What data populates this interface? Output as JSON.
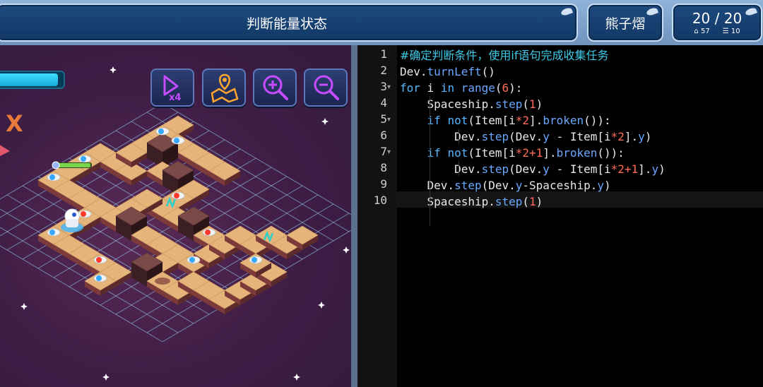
{
  "header": {
    "title": "判断能量状态",
    "user_name": "熊子熠",
    "score": "20 / 20",
    "stat_left": "57",
    "stat_right": "10"
  },
  "toolbar": {
    "speed_label": "x4",
    "tools": [
      "speed-x4-icon",
      "map-route-icon",
      "zoom-in-icon",
      "zoom-out-icon"
    ]
  },
  "game": {
    "x_marker": "X",
    "energy_level": 0.92
  },
  "editor": {
    "line_numbers": [
      "1",
      "2",
      "3",
      "4",
      "5",
      "6",
      "7",
      "8",
      "9",
      "10"
    ],
    "lines": [
      [
        {
          "t": "cm",
          "v": "#确定判断条件，使用if语句完成收集任务"
        }
      ],
      [
        {
          "t": "fn",
          "v": "Dev."
        },
        {
          "t": "me",
          "v": "turnLeft"
        },
        {
          "t": "fn",
          "v": "()"
        }
      ],
      [
        {
          "t": "kw",
          "v": "for"
        },
        {
          "t": "fn",
          "v": " i "
        },
        {
          "t": "kw",
          "v": "in"
        },
        {
          "t": "fn",
          "v": " "
        },
        {
          "t": "me",
          "v": "range"
        },
        {
          "t": "fn",
          "v": "("
        },
        {
          "t": "num",
          "v": "6"
        },
        {
          "t": "fn",
          "v": "):"
        }
      ],
      [
        {
          "t": "fn",
          "v": "    Spaceship."
        },
        {
          "t": "me",
          "v": "step"
        },
        {
          "t": "fn",
          "v": "("
        },
        {
          "t": "num",
          "v": "1"
        },
        {
          "t": "fn",
          "v": ")"
        }
      ],
      [
        {
          "t": "fn",
          "v": "    "
        },
        {
          "t": "kw",
          "v": "if"
        },
        {
          "t": "fn",
          "v": " "
        },
        {
          "t": "kw",
          "v": "not"
        },
        {
          "t": "fn",
          "v": "(Item[i"
        },
        {
          "t": "num",
          "v": "*2"
        },
        {
          "t": "fn",
          "v": "]."
        },
        {
          "t": "me",
          "v": "broken"
        },
        {
          "t": "fn",
          "v": "()):"
        }
      ],
      [
        {
          "t": "fn",
          "v": "        Dev."
        },
        {
          "t": "me",
          "v": "step"
        },
        {
          "t": "fn",
          "v": "(Dev."
        },
        {
          "t": "me",
          "v": "y"
        },
        {
          "t": "fn",
          "v": " - Item[i"
        },
        {
          "t": "num",
          "v": "*2"
        },
        {
          "t": "fn",
          "v": "]."
        },
        {
          "t": "me",
          "v": "y"
        },
        {
          "t": "fn",
          "v": ")"
        }
      ],
      [
        {
          "t": "fn",
          "v": "    "
        },
        {
          "t": "kw",
          "v": "if"
        },
        {
          "t": "fn",
          "v": " "
        },
        {
          "t": "kw",
          "v": "not"
        },
        {
          "t": "fn",
          "v": "(Item[i"
        },
        {
          "t": "num",
          "v": "*2+1"
        },
        {
          "t": "fn",
          "v": "]."
        },
        {
          "t": "me",
          "v": "broken"
        },
        {
          "t": "fn",
          "v": "()):"
        }
      ],
      [
        {
          "t": "fn",
          "v": "        Dev."
        },
        {
          "t": "me",
          "v": "step"
        },
        {
          "t": "fn",
          "v": "(Dev."
        },
        {
          "t": "me",
          "v": "y"
        },
        {
          "t": "fn",
          "v": " - Item[i"
        },
        {
          "t": "num",
          "v": "*2+1"
        },
        {
          "t": "fn",
          "v": "]."
        },
        {
          "t": "me",
          "v": "y"
        },
        {
          "t": "fn",
          "v": ")"
        }
      ],
      [
        {
          "t": "fn",
          "v": "    Dev."
        },
        {
          "t": "me",
          "v": "step"
        },
        {
          "t": "fn",
          "v": "(Dev."
        },
        {
          "t": "me",
          "v": "y"
        },
        {
          "t": "fn",
          "v": "-Spaceship."
        },
        {
          "t": "me",
          "v": "y"
        },
        {
          "t": "fn",
          "v": ")"
        }
      ],
      [
        {
          "t": "fn",
          "v": "    Spaceship."
        },
        {
          "t": "me",
          "v": "step"
        },
        {
          "t": "fn",
          "v": "("
        },
        {
          "t": "num",
          "v": "1"
        },
        {
          "t": "fn",
          "v": ")"
        }
      ]
    ]
  }
}
